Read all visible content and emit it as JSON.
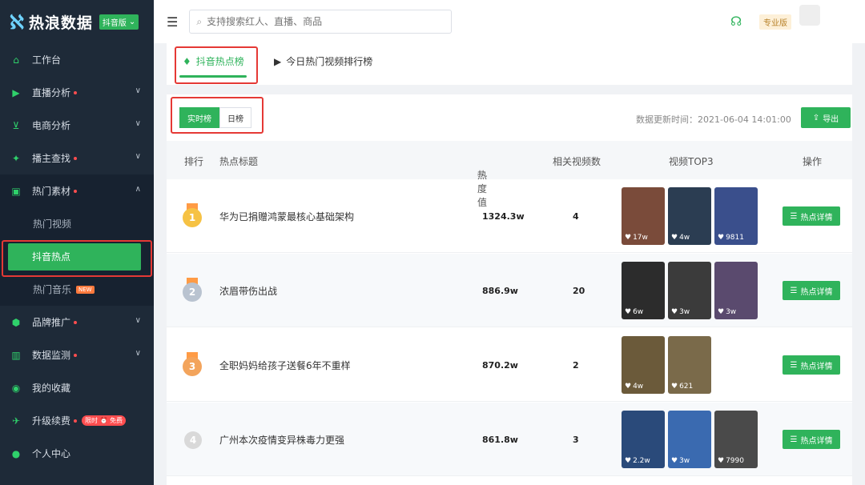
{
  "app": {
    "name": "热浪数据",
    "badge": "抖音版"
  },
  "sidebar": {
    "items": [
      {
        "label": "工作台"
      },
      {
        "label": "直播分析"
      },
      {
        "label": "电商分析"
      },
      {
        "label": "播主查找"
      },
      {
        "label": "热门素材"
      },
      {
        "label": "品牌推广"
      },
      {
        "label": "数据监测"
      },
      {
        "label": "我的收藏"
      },
      {
        "label": "升级续费"
      },
      {
        "label": "个人中心"
      }
    ],
    "sub_items": [
      {
        "label": "热门视频"
      },
      {
        "label": "抖音热点"
      },
      {
        "label": "热门音乐",
        "tag": "NEW"
      }
    ],
    "upgrade_tags": {
      "limited": "限时",
      "free": "免费"
    }
  },
  "topbar": {
    "search_placeholder": "支持搜索红人、直播、商品",
    "pro_label": "专业版"
  },
  "tabs": [
    {
      "label": "抖音热点榜"
    },
    {
      "label": "今日热门视频排行榜"
    }
  ],
  "toolbar": {
    "realtime_label": "实时榜",
    "daily_label": "日榜",
    "update_time": "数据更新时间：2021-06-04 14:01:00",
    "export_label": "导出"
  },
  "table": {
    "headers": [
      "排行",
      "热点标题",
      "热度值",
      "相关视频数",
      "视频TOP3",
      "操作"
    ],
    "detail_label": "热点详情",
    "rows": [
      {
        "rank": "1",
        "title": "华为已捐赠鸿蒙最核心基础架构",
        "heat": "1324.3w",
        "count": "4",
        "thumbs": [
          {
            "likes": "17w",
            "color": "#7a4b3a"
          },
          {
            "likes": "4w",
            "color": "#2b3d52"
          },
          {
            "likes": "9811",
            "color": "#3a4f8c"
          }
        ]
      },
      {
        "rank": "2",
        "title": "浓眉带伤出战",
        "heat": "886.9w",
        "count": "20",
        "thumbs": [
          {
            "likes": "6w",
            "color": "#2c2c2c"
          },
          {
            "likes": "3w",
            "color": "#3b3b3b"
          },
          {
            "likes": "3w",
            "color": "#5a4a6e"
          }
        ]
      },
      {
        "rank": "3",
        "title": "全职妈妈给孩子送餐6年不重样",
        "heat": "870.2w",
        "count": "2",
        "thumbs": [
          {
            "likes": "4w",
            "color": "#6b5a3a"
          },
          {
            "likes": "621",
            "color": "#7a6a4a"
          }
        ]
      },
      {
        "rank": "4",
        "title": "广州本次疫情变异株毒力更强",
        "heat": "861.8w",
        "count": "3",
        "thumbs": [
          {
            "likes": "2.2w",
            "color": "#2a4a7a"
          },
          {
            "likes": "3w",
            "color": "#3a6ab0"
          },
          {
            "likes": "7990",
            "color": "#4a4a4a"
          }
        ]
      }
    ]
  }
}
